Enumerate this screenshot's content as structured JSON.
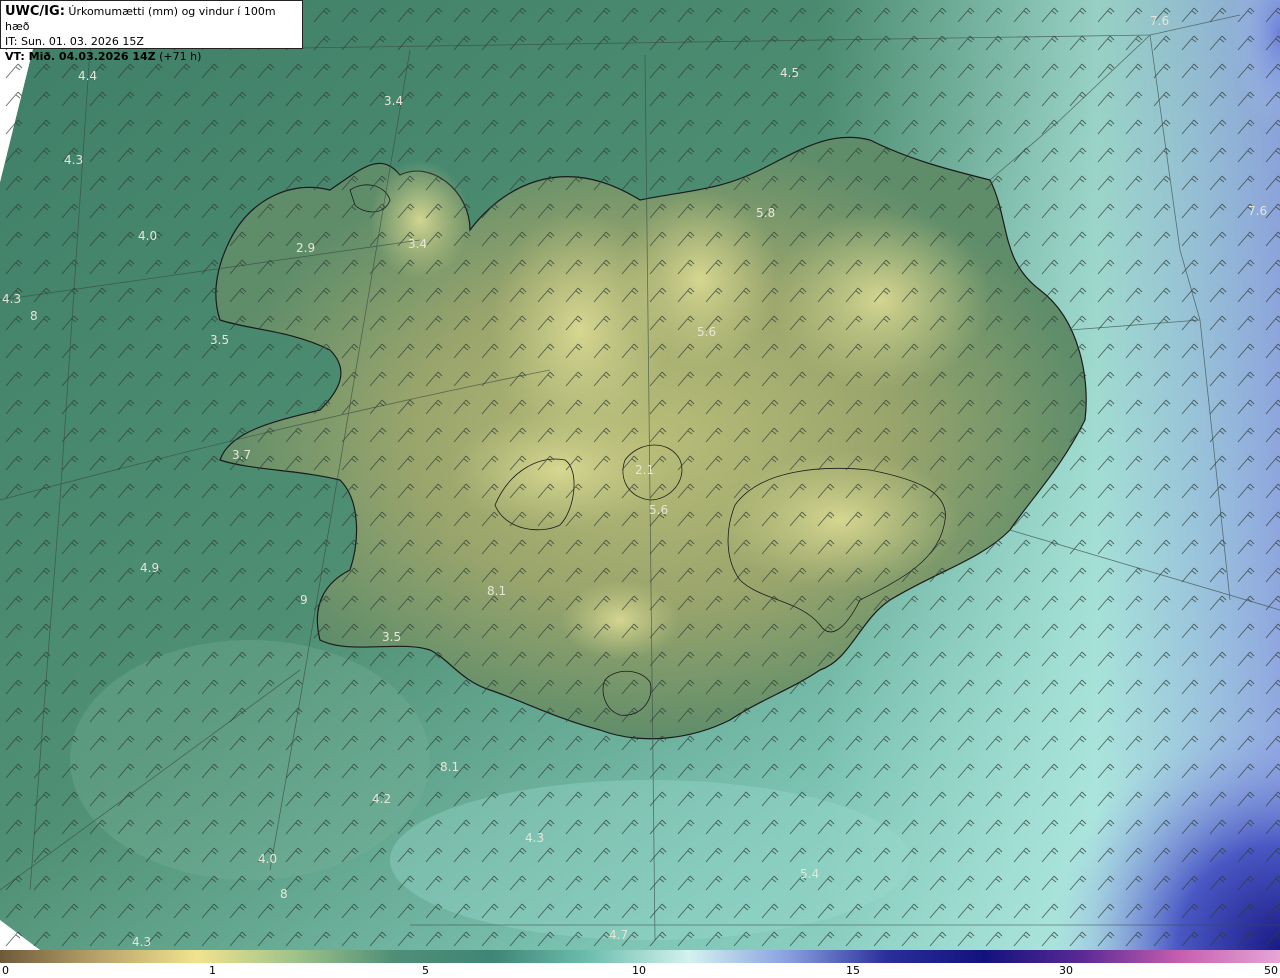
{
  "header": {
    "source": "UWC/IG:",
    "title": "Úrkomumætti (mm) og vindur í 100m hæð",
    "issue_time": "IT: Sun. 01. 03. 2026 15Z",
    "valid_label": "VT: Mið. 04.03.2026 14Z",
    "valid_offset": "(+71 h)"
  },
  "colorbar": {
    "ticks": [
      "0",
      "1",
      "5",
      "10",
      "15",
      "30",
      "50"
    ],
    "colors": [
      "#6e5a3a",
      "#b9a36a",
      "#f1e38e",
      "#9fc28a",
      "#4f8f77",
      "#3e8676",
      "#6fbfae",
      "#d3f2ef",
      "#8aa0e0",
      "#2a2f9b",
      "#12127e",
      "#5b2a96",
      "#c85fb0",
      "#e6a6d6"
    ]
  },
  "map_labels": [
    {
      "text": "4.4"
    },
    {
      "text": "3.4"
    },
    {
      "text": "4.5"
    },
    {
      "text": "7.6"
    },
    {
      "text": "4.3"
    },
    {
      "text": "4.0"
    },
    {
      "text": "2.9"
    },
    {
      "text": "3.4"
    },
    {
      "text": "5.8"
    },
    {
      "text": "7.6"
    },
    {
      "text": "4.3"
    },
    {
      "text": "8"
    },
    {
      "text": "5.6"
    },
    {
      "text": "3.5"
    },
    {
      "text": "3.7"
    },
    {
      "text": "2.1"
    },
    {
      "text": "5.6"
    },
    {
      "text": "4.9"
    },
    {
      "text": "9"
    },
    {
      "text": "8.1"
    },
    {
      "text": "3.5"
    },
    {
      "text": "8.1"
    },
    {
      "text": "4.2"
    },
    {
      "text": "4.3"
    },
    {
      "text": "4.0"
    },
    {
      "text": "5.4"
    },
    {
      "text": "8"
    },
    {
      "text": "4.3"
    },
    {
      "text": "4.7"
    }
  ]
}
